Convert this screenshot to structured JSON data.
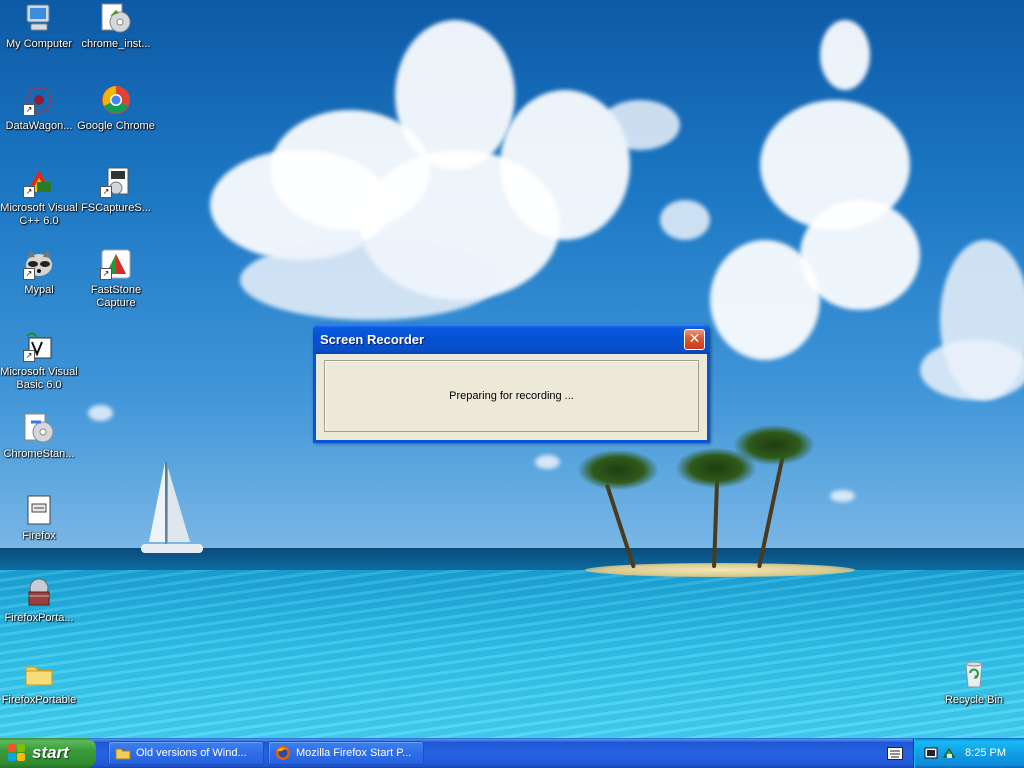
{
  "desktop": {
    "icons": [
      {
        "label": "My Computer",
        "icon": "my-computer-icon"
      },
      {
        "label": "chrome_inst...",
        "icon": "installer-cd-icon"
      },
      {
        "label": "DataWagon...",
        "icon": "datawagon-icon"
      },
      {
        "label": "Google Chrome",
        "icon": "chrome-icon"
      },
      {
        "label": "Microsoft Visual C++ 6.0",
        "icon": "visual-cpp-icon"
      },
      {
        "label": "FSCaptureS...",
        "icon": "installer-icon"
      },
      {
        "label": "Mypal",
        "icon": "mypal-raccoon-icon"
      },
      {
        "label": "FastStone Capture",
        "icon": "faststone-capture-icon"
      },
      {
        "label": "Microsoft Visual Basic 6.0",
        "icon": "visual-basic-icon"
      },
      {
        "label": "ChromeStan...",
        "icon": "installer-cd-icon"
      },
      {
        "label": "Firefox",
        "icon": "document-icon"
      },
      {
        "label": "FirefoxPorta...",
        "icon": "installer-box-icon"
      },
      {
        "label": "FirefoxPortable",
        "icon": "folder-icon"
      },
      {
        "label": "Recycle Bin",
        "icon": "recycle-bin-icon"
      }
    ]
  },
  "dialog": {
    "title": "Screen Recorder",
    "message": "Preparing for recording ...",
    "close_icon": "close-icon"
  },
  "taskbar": {
    "start_label": "start",
    "tasks": [
      {
        "label": "Old versions of Wind...",
        "icon": "folder-icon"
      },
      {
        "label": "Mozilla Firefox Start P...",
        "icon": "firefox-icon"
      }
    ],
    "tray": {
      "clock": "8:25 PM"
    }
  },
  "colors": {
    "taskbar_blue": "#2663e0",
    "start_green": "#3a9d3a",
    "title_blue": "#0450d4",
    "dialog_face": "#ece9d8",
    "close_red": "#d9582f"
  }
}
